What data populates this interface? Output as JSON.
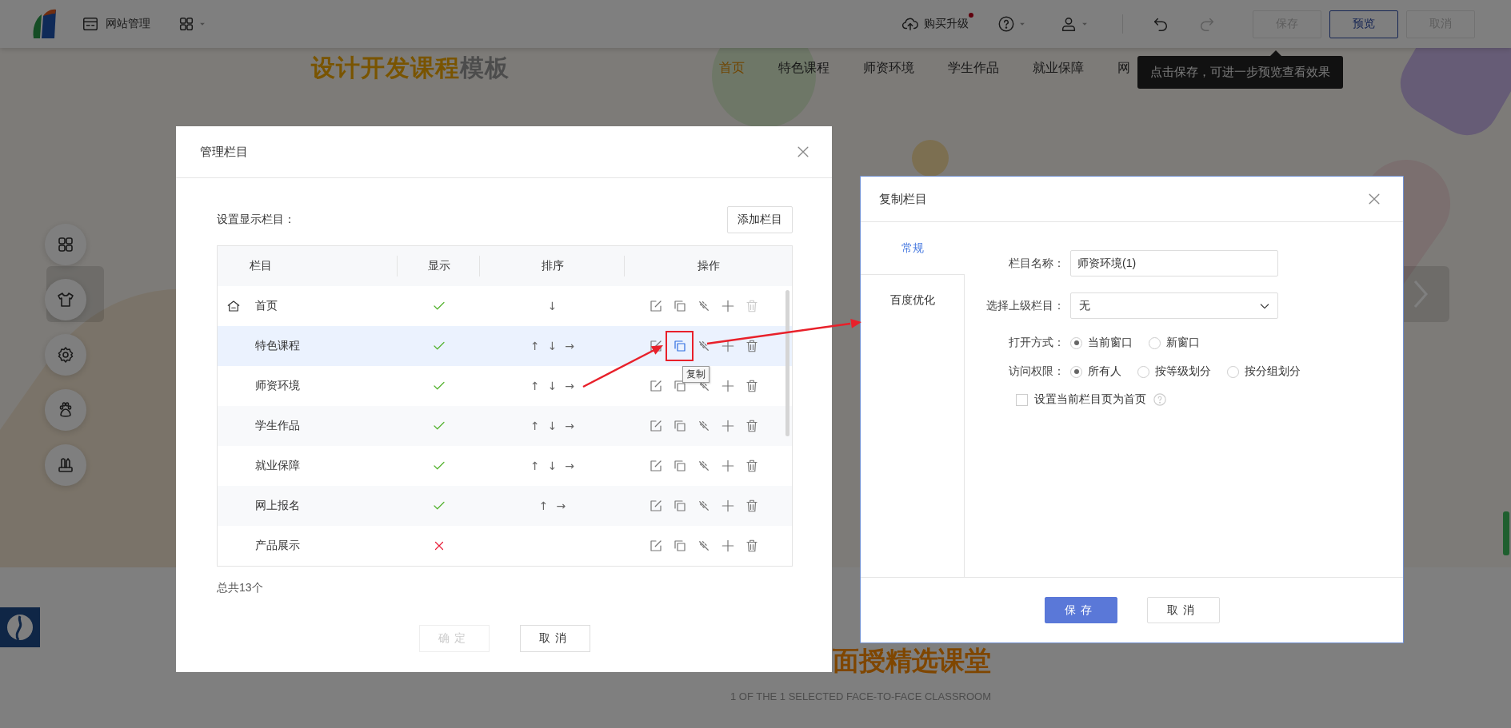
{
  "topbar": {
    "site_menu": "网站管理",
    "upgrade": {
      "label": "购买升级",
      "notification": true
    },
    "redo_disabled": true,
    "actions": [
      {
        "label": "保存",
        "disabled": true,
        "kind": "default"
      },
      {
        "label": "预览",
        "disabled": false,
        "kind": "primary"
      },
      {
        "label": "取消",
        "disabled": true,
        "kind": "default"
      }
    ],
    "tooltip": "点击保存，可进一步预览查看效果"
  },
  "site": {
    "title_accent": "设计开发课程",
    "title_rest": "模板",
    "nav": [
      {
        "label": "首页",
        "selected": true
      },
      {
        "label": "特色课程",
        "selected": false
      },
      {
        "label": "师资环境",
        "selected": false
      },
      {
        "label": "学生作品",
        "selected": false
      },
      {
        "label": "就业保障",
        "selected": false
      },
      {
        "label": "网",
        "selected": false
      }
    ],
    "section": {
      "title": "面授精选课堂",
      "subtitle": "1 OF THE 1 SELECTED FACE-TO-FACE CLASSROOM"
    }
  },
  "manage_dialog": {
    "title": "管理栏目",
    "caption": "设置显示栏目：",
    "add_button": "添加栏目",
    "columns": [
      "栏目",
      "显示",
      "排序",
      "操作"
    ],
    "rows": [
      {
        "name": "首页",
        "home": true,
        "shown": true,
        "sort": [
          "↓"
        ],
        "selected": false,
        "delete_disabled": true
      },
      {
        "name": "特色课程",
        "home": false,
        "shown": true,
        "sort": [
          "↑",
          "↓",
          "→"
        ],
        "selected": true,
        "delete_disabled": false,
        "hover_tip": "复制"
      },
      {
        "name": "师资环境",
        "home": false,
        "shown": true,
        "sort": [
          "↑",
          "↓",
          "→"
        ],
        "selected": false,
        "delete_disabled": false
      },
      {
        "name": "学生作品",
        "home": false,
        "shown": true,
        "sort": [
          "↑",
          "↓",
          "→"
        ],
        "selected": false,
        "delete_disabled": false
      },
      {
        "name": "就业保障",
        "home": false,
        "shown": true,
        "sort": [
          "↑",
          "↓",
          "→"
        ],
        "selected": false,
        "delete_disabled": false
      },
      {
        "name": "网上报名",
        "home": false,
        "shown": true,
        "sort": [
          "↑",
          "→"
        ],
        "selected": false,
        "delete_disabled": false
      },
      {
        "name": "产品展示",
        "home": false,
        "shown": false,
        "selected": false,
        "delete_disabled": false
      }
    ],
    "total": "总共13个",
    "buttons": [
      {
        "label": "确定",
        "disabled": true
      },
      {
        "label": "取消",
        "disabled": false
      }
    ]
  },
  "copy_dialog": {
    "title": "复制栏目",
    "tabs": [
      {
        "label": "常规",
        "selected": true
      },
      {
        "label": "百度优化",
        "selected": false
      }
    ],
    "name_field": {
      "label": "栏目名称：",
      "value": "师资环境(1)"
    },
    "parent_select": {
      "label": "选择上级栏目：",
      "value": "无"
    },
    "radio_groups": [
      {
        "label": "打开方式：",
        "options": [
          {
            "label": "当前窗口",
            "selected": true
          },
          {
            "label": "新窗口",
            "selected": false
          }
        ]
      },
      {
        "label": "访问权限：",
        "options": [
          {
            "label": "所有人",
            "selected": true
          },
          {
            "label": "按等级划分",
            "selected": false
          },
          {
            "label": "按分组划分",
            "selected": false
          }
        ]
      }
    ],
    "homepage_checkbox": {
      "label": "设置当前栏目页为首页",
      "checked": false
    },
    "buttons": [
      {
        "label": "保存",
        "kind": "primary"
      },
      {
        "label": "取消",
        "kind": "default"
      }
    ]
  }
}
